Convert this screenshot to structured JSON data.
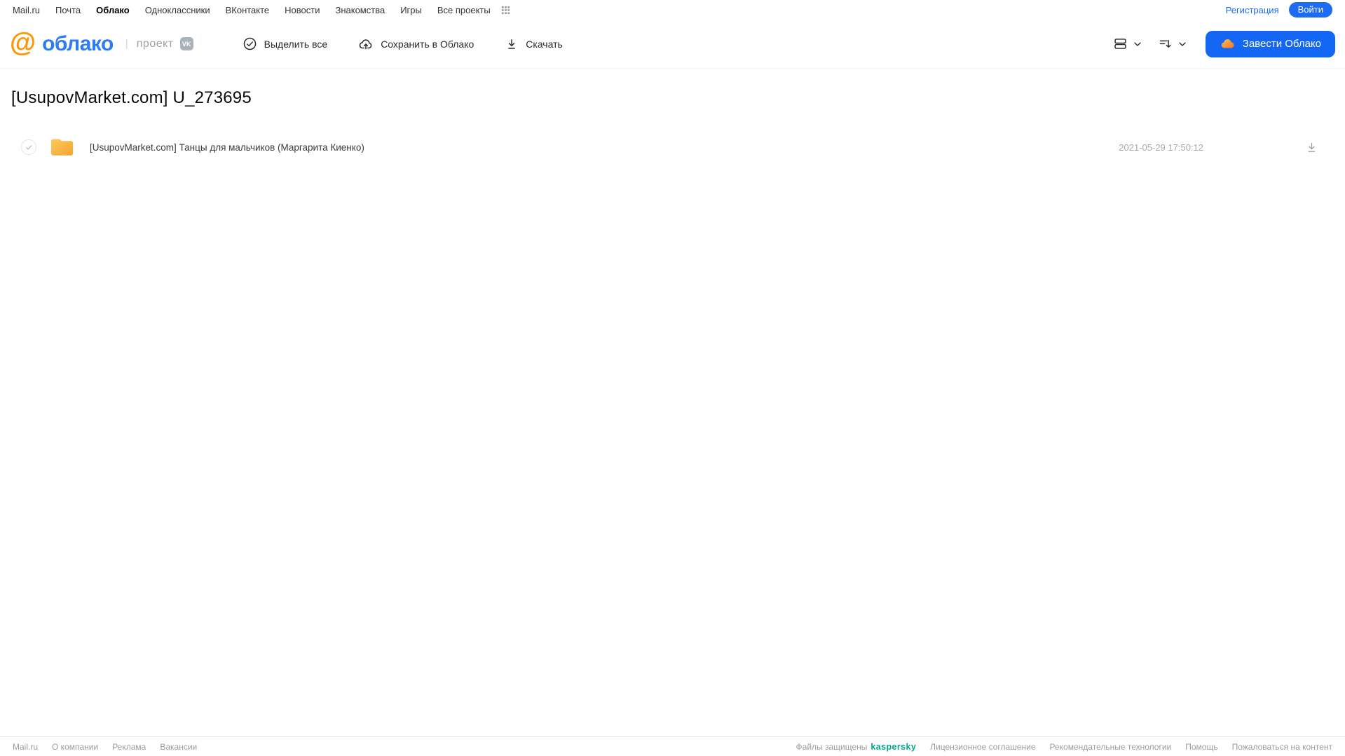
{
  "topnav": {
    "links": [
      "Mail.ru",
      "Почта",
      "Облако",
      "Одноклассники",
      "ВКонтакте",
      "Новости",
      "Знакомства",
      "Игры",
      "Все проекты"
    ],
    "active_link": "Облако",
    "registration_label": "Регистрация",
    "login_label": "Войти"
  },
  "header": {
    "logo_at": "@",
    "logo_word": "облако",
    "logo_divider": "|",
    "project_label": "проект",
    "vk_badge": "VK",
    "toolbar": {
      "select_all_label": "Выделить все",
      "save_to_cloud_label": "Сохранить в Облако",
      "download_label": "Скачать"
    },
    "cta_label": "Завести Облако"
  },
  "page": {
    "title": "[UsupovMarket.com] U_273695"
  },
  "files": [
    {
      "name": "[UsupovMarket.com] Танцы для мальчиков (Маргарита Киенко)",
      "date": "2021-05-29 17:50:12",
      "type": "folder"
    }
  ],
  "footer": {
    "left_links": [
      "Mail.ru",
      "О компании",
      "Реклама",
      "Вакансии"
    ],
    "protected_label": "Файлы защищены",
    "kaspersky_label": "kaspersky",
    "right_links": [
      "Лицензионное соглашение",
      "Рекомендательные технологии",
      "Помощь",
      "Пожаловаться на контент"
    ]
  },
  "colors": {
    "accent_blue": "#1467f2",
    "logo_blue": "#2d7cf6",
    "logo_orange": "#ff9500",
    "folder_gradient_start": "#fdca5f",
    "folder_gradient_end": "#f5a42e",
    "kaspersky_green": "#00a88e"
  }
}
